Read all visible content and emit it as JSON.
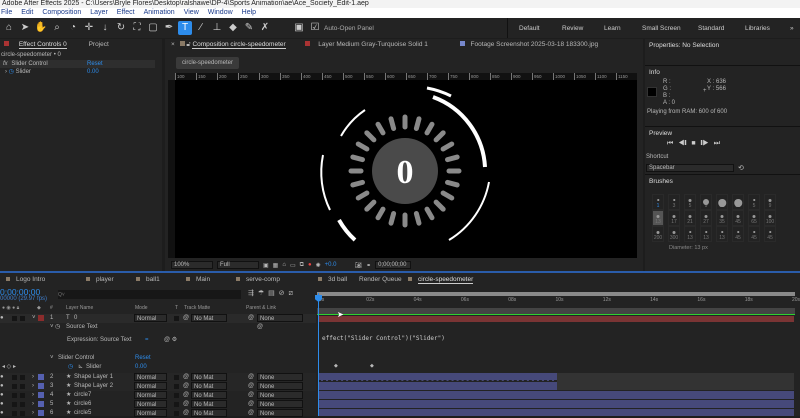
{
  "window": {
    "title": "Adobe After Effects 2025 - C:\\Users\\Bryle Flores\\Desktop\\ralshawe\\DP-4\\Sports Animation\\ae\\Ace_Society_Edit-1.aep"
  },
  "menu": [
    "File",
    "Edit",
    "Composition",
    "Layer",
    "Effect",
    "Animation",
    "View",
    "Window",
    "Help"
  ],
  "toolbar": {
    "auto_open": "Auto-Open Panel",
    "workspaces": [
      "Default",
      "Review",
      "Learn",
      "Small Screen",
      "Standard",
      "Libraries"
    ],
    "more": "»"
  },
  "effect_controls": {
    "tab": "Effect Controls 0",
    "project_tab": "Project",
    "target": "circle-speedometer • 0",
    "effect": "Slider Control",
    "reset": "Reset",
    "param": "Slider",
    "value": "0.00"
  },
  "composition": {
    "tab": "Composition circle-speedometer",
    "layer_tab": "Layer Medium Gray-Turquoise Solid 1",
    "footage_tab": "Footage Screenshot 2025-03-18 183300.jpg",
    "breadcrumb": "circle-speedometer",
    "ruler": [
      "100",
      "150",
      "200",
      "250",
      "300",
      "350",
      "400",
      "450",
      "500",
      "550",
      "600",
      "650",
      "700",
      "750",
      "800",
      "850",
      "900",
      "950",
      "1000",
      "1050",
      "1100",
      "1150"
    ],
    "display_value": "0",
    "zoom": "100%",
    "resolution": "Full",
    "exposure": "+0.0",
    "timecode": "0;00;00;00"
  },
  "properties": {
    "title": "Properties: No Selection"
  },
  "info": {
    "title": "Info",
    "r": "R :",
    "g": "G :",
    "b": "B :",
    "a": "A :  0",
    "x": "X : 636",
    "y": "Y :  566",
    "status": "Playing from RAM: 600 of 600"
  },
  "preview": {
    "title": "Preview",
    "shortcut_label": "Shortcut",
    "shortcut": "Spacebar"
  },
  "brushes": {
    "title": "Brushes",
    "sizes": [
      "1",
      "3",
      "5",
      "9",
      "13",
      "19",
      "5",
      "9",
      "13",
      "17",
      "21",
      "27",
      "35",
      "45",
      "65",
      "100",
      "200",
      "300",
      "13",
      "13",
      "13",
      "45",
      "45",
      "45"
    ],
    "diameter": "Diameter: 13 px"
  },
  "timeline": {
    "tabs": [
      "Logo Intro",
      "player",
      "ball1",
      "Main",
      "serve-comp",
      "3d ball",
      "Render Queue",
      "circle-speedometer"
    ],
    "timecode": "0;00;00;00",
    "fps": "00000 (29.97 fps)",
    "search_placeholder": "Q˅",
    "headers": {
      "num": "#",
      "name": "Layer Name",
      "mode": "Mode",
      "t": "T",
      "matte": "Track Matte",
      "parent": "Parent & Link"
    },
    "time_ticks": [
      "0s",
      "02s",
      "04s",
      "06s",
      "08s",
      "10s",
      "12s",
      "14s",
      "16s",
      "18s",
      "20s"
    ],
    "layers": [
      {
        "num": "1",
        "icon": "T",
        "name": "0",
        "mode": "Normal",
        "matte": "No Mat",
        "parent": "None",
        "color": "#8b2c2c"
      },
      {
        "num": "2",
        "icon": "★",
        "name": "Shape Layer 1",
        "mode": "Normal",
        "matte": "No Mat",
        "parent": "None",
        "color": "#5560b0"
      },
      {
        "num": "3",
        "icon": "★",
        "name": "Shape Layer 2",
        "mode": "Normal",
        "matte": "No Mat",
        "parent": "None",
        "color": "#5560b0"
      },
      {
        "num": "4",
        "icon": "★",
        "name": "circle7",
        "mode": "Normal",
        "matte": "No Mat",
        "parent": "None",
        "color": "#5560b0"
      },
      {
        "num": "5",
        "icon": "★",
        "name": "circle6",
        "mode": "Normal",
        "matte": "No Mat",
        "parent": "None",
        "color": "#5560b0"
      },
      {
        "num": "6",
        "icon": "★",
        "name": "circle5",
        "mode": "Normal",
        "matte": "No Mat",
        "parent": "None",
        "color": "#5560b0"
      }
    ],
    "source_text": "Source Text",
    "expression_label": "Expression: Source Text",
    "expression": "effect(\"Slider Control\")(\"Slider\")",
    "slider_control": "Slider Control",
    "reset": "Reset",
    "slider": "Slider",
    "slider_value": "0.00"
  }
}
